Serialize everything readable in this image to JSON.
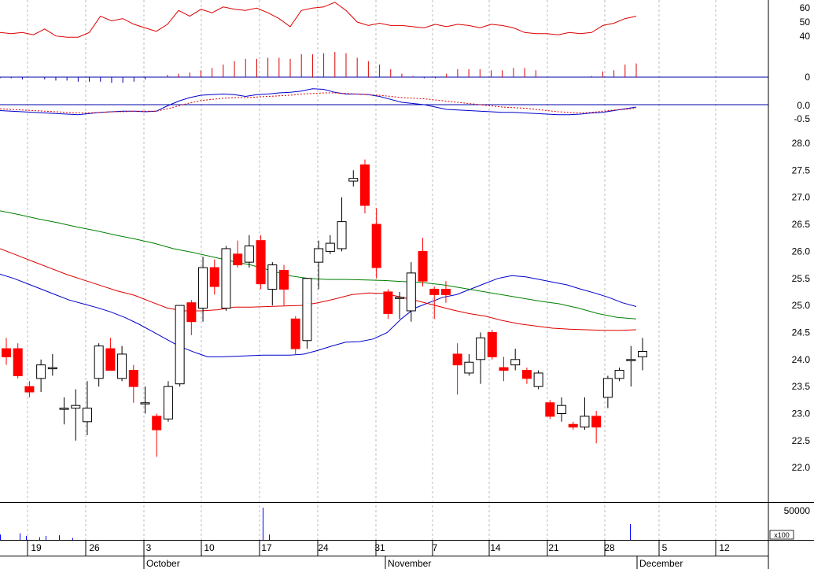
{
  "colors": {
    "up": "#ffffff",
    "down": "#ff0000",
    "outline": "#000000",
    "ma_short": "#0000cc",
    "ma_mid": "#dd0000",
    "ma_long": "#008000",
    "macd": "#0000cc",
    "signal": "#dd0000",
    "rsi": "#dd0000",
    "volume": "#0000ff",
    "grid": "#bbbbbb",
    "baseline": "#0000aa"
  },
  "chart_data": [
    {
      "type": "line",
      "panel": "rsi",
      "y_ticks": [
        "60",
        "50",
        "40"
      ],
      "ylim": [
        28,
        66
      ],
      "values": [
        38,
        37,
        38,
        36,
        41,
        35,
        34,
        34,
        38,
        52,
        48,
        50,
        45,
        42,
        39,
        45,
        57,
        52,
        58,
        55,
        60,
        58,
        57,
        59,
        55,
        50,
        43,
        57,
        59,
        60,
        64,
        57,
        47,
        44,
        46,
        44,
        44,
        43,
        42,
        45,
        43,
        45,
        44,
        42,
        45,
        44,
        42,
        38,
        37,
        37,
        36,
        38,
        37,
        38,
        44,
        46,
        50,
        52
      ]
    },
    {
      "type": "bar",
      "panel": "momentum",
      "y_ticks": [
        "0"
      ],
      "values": [
        -1,
        -1,
        -2,
        0,
        -2,
        -3,
        -3,
        -4,
        -4,
        -4,
        -5,
        -5,
        -4,
        -2,
        0,
        2,
        3,
        4,
        6,
        8,
        11,
        14,
        16,
        16,
        17,
        17,
        16,
        20,
        20,
        21,
        22,
        21,
        17,
        14,
        11,
        7,
        3,
        1,
        -1,
        -1,
        3,
        7,
        7,
        7,
        6,
        6,
        8,
        8,
        6,
        0,
        0,
        0,
        0,
        1,
        5,
        6,
        11,
        12
      ]
    },
    {
      "type": "line",
      "panel": "macd",
      "y_ticks": [
        "0.0",
        "-0.5"
      ],
      "ylim": [
        -1.4,
        1.5
      ],
      "series": [
        {
          "role": "macd",
          "values": [
            -0.5,
            -0.55,
            -0.6,
            -0.65,
            -0.7,
            -0.75,
            -0.8,
            -0.85,
            -0.75,
            -0.65,
            -0.6,
            -0.55,
            -0.55,
            -0.6,
            -0.55,
            -0.1,
            0.3,
            0.6,
            0.8,
            0.85,
            0.9,
            0.85,
            0.7,
            0.85,
            0.9,
            1.0,
            1.05,
            1.15,
            1.35,
            1.3,
            1.05,
            0.9,
            0.9,
            0.85,
            0.7,
            0.45,
            0.2,
            0.1,
            0.0,
            -0.2,
            -0.4,
            -0.45,
            -0.5,
            -0.55,
            -0.6,
            -0.65,
            -0.65,
            -0.7,
            -0.75,
            -0.8,
            -0.85,
            -0.85,
            -0.8,
            -0.7,
            -0.65,
            -0.5,
            -0.35,
            -0.2
          ]
        },
        {
          "role": "signal",
          "values": [
            -0.35,
            -0.4,
            -0.45,
            -0.5,
            -0.55,
            -0.6,
            -0.65,
            -0.7,
            -0.7,
            -0.65,
            -0.6,
            -0.6,
            -0.55,
            -0.55,
            -0.55,
            -0.35,
            -0.1,
            0.15,
            0.35,
            0.45,
            0.55,
            0.6,
            0.6,
            0.65,
            0.7,
            0.75,
            0.8,
            0.9,
            0.95,
            1.0,
            1.0,
            0.95,
            0.9,
            0.85,
            0.8,
            0.7,
            0.6,
            0.55,
            0.5,
            0.4,
            0.3,
            0.2,
            0.1,
            0.0,
            -0.1,
            -0.2,
            -0.25,
            -0.3,
            -0.4,
            -0.5,
            -0.6,
            -0.65,
            -0.7,
            -0.65,
            -0.55,
            -0.45,
            -0.4,
            -0.3
          ]
        }
      ]
    },
    {
      "type": "candlestick",
      "panel": "price",
      "y_ticks": [
        "28.0",
        "27.5",
        "27.0",
        "26.5",
        "26.0",
        "25.5",
        "25.0",
        "24.5",
        "24.0",
        "23.5",
        "23.0",
        "22.5",
        "22.0"
      ],
      "ylim": [
        21.6,
        28.4
      ],
      "candles": [
        {
          "o": 24.2,
          "h": 24.4,
          "l": 23.9,
          "c": 24.05
        },
        {
          "o": 24.2,
          "h": 24.3,
          "l": 23.65,
          "c": 23.7
        },
        {
          "o": 23.5,
          "h": 23.6,
          "l": 23.3,
          "c": 23.4
        },
        {
          "o": 23.65,
          "h": 24.0,
          "l": 23.4,
          "c": 23.9
        },
        {
          "o": 23.85,
          "h": 24.1,
          "l": 23.7,
          "c": 23.85
        },
        {
          "o": 23.1,
          "h": 23.3,
          "l": 22.8,
          "c": 23.1
        },
        {
          "o": 23.1,
          "h": 23.45,
          "l": 22.5,
          "c": 23.15
        },
        {
          "o": 22.85,
          "h": 23.6,
          "l": 22.6,
          "c": 23.1
        },
        {
          "o": 23.65,
          "h": 24.3,
          "l": 23.5,
          "c": 24.25
        },
        {
          "o": 24.2,
          "h": 24.4,
          "l": 23.8,
          "c": 23.8
        },
        {
          "o": 23.65,
          "h": 24.25,
          "l": 23.6,
          "c": 24.1
        },
        {
          "o": 23.8,
          "h": 23.9,
          "l": 23.2,
          "c": 23.5
        },
        {
          "o": 23.2,
          "h": 23.5,
          "l": 23.0,
          "c": 23.2
        },
        {
          "o": 22.95,
          "h": 23.0,
          "l": 22.2,
          "c": 22.7
        },
        {
          "o": 22.9,
          "h": 23.6,
          "l": 22.85,
          "c": 23.5
        },
        {
          "o": 23.55,
          "h": 25.0,
          "l": 23.5,
          "c": 25.0
        },
        {
          "o": 25.05,
          "h": 25.1,
          "l": 24.45,
          "c": 24.7
        },
        {
          "o": 24.95,
          "h": 25.9,
          "l": 24.7,
          "c": 25.7
        },
        {
          "o": 25.7,
          "h": 25.85,
          "l": 25.2,
          "c": 25.35
        },
        {
          "o": 24.95,
          "h": 26.1,
          "l": 24.9,
          "c": 26.05
        },
        {
          "o": 25.95,
          "h": 26.2,
          "l": 25.7,
          "c": 25.75
        },
        {
          "o": 25.8,
          "h": 26.3,
          "l": 25.7,
          "c": 26.1
        },
        {
          "o": 26.2,
          "h": 26.3,
          "l": 25.3,
          "c": 25.4
        },
        {
          "o": 25.3,
          "h": 25.8,
          "l": 25.0,
          "c": 25.75
        },
        {
          "o": 25.65,
          "h": 25.75,
          "l": 25.0,
          "c": 25.3
        },
        {
          "o": 24.75,
          "h": 24.8,
          "l": 24.1,
          "c": 24.2
        },
        {
          "o": 24.35,
          "h": 25.5,
          "l": 24.2,
          "c": 25.5
        },
        {
          "o": 25.8,
          "h": 26.2,
          "l": 25.3,
          "c": 26.05
        },
        {
          "o": 26.0,
          "h": 26.3,
          "l": 25.95,
          "c": 26.15
        },
        {
          "o": 26.05,
          "h": 27.0,
          "l": 26.0,
          "c": 26.55
        },
        {
          "o": 27.3,
          "h": 27.5,
          "l": 27.2,
          "c": 27.35
        },
        {
          "o": 27.6,
          "h": 27.7,
          "l": 26.7,
          "c": 26.85
        },
        {
          "o": 26.5,
          "h": 26.8,
          "l": 25.5,
          "c": 25.7
        },
        {
          "o": 25.25,
          "h": 25.3,
          "l": 24.75,
          "c": 24.85
        },
        {
          "o": 25.15,
          "h": 25.25,
          "l": 24.75,
          "c": 25.15
        },
        {
          "o": 24.9,
          "h": 25.8,
          "l": 24.7,
          "c": 25.6
        },
        {
          "o": 26.0,
          "h": 26.25,
          "l": 25.35,
          "c": 25.45
        },
        {
          "o": 25.3,
          "h": 25.35,
          "l": 24.75,
          "c": 25.2
        },
        {
          "o": 25.3,
          "h": 25.45,
          "l": 25.05,
          "c": 25.2
        },
        {
          "o": 24.1,
          "h": 24.3,
          "l": 23.35,
          "c": 23.9
        },
        {
          "o": 23.75,
          "h": 24.1,
          "l": 23.7,
          "c": 23.95
        },
        {
          "o": 24.0,
          "h": 24.5,
          "l": 23.55,
          "c": 24.4
        },
        {
          "o": 24.5,
          "h": 24.55,
          "l": 24.0,
          "c": 24.05
        },
        {
          "o": 23.85,
          "h": 24.05,
          "l": 23.6,
          "c": 23.8
        },
        {
          "o": 23.9,
          "h": 24.2,
          "l": 23.8,
          "c": 24.0
        },
        {
          "o": 23.8,
          "h": 23.85,
          "l": 23.55,
          "c": 23.65
        },
        {
          "o": 23.5,
          "h": 23.8,
          "l": 23.45,
          "c": 23.75
        },
        {
          "o": 23.2,
          "h": 23.25,
          "l": 22.9,
          "c": 22.95
        },
        {
          "o": 23.0,
          "h": 23.3,
          "l": 22.85,
          "c": 23.15
        },
        {
          "o": 22.8,
          "h": 22.85,
          "l": 22.7,
          "c": 22.75
        },
        {
          "o": 22.75,
          "h": 23.3,
          "l": 22.7,
          "c": 22.95
        },
        {
          "o": 22.95,
          "h": 23.05,
          "l": 22.45,
          "c": 22.75
        },
        {
          "o": 23.3,
          "h": 23.7,
          "l": 23.1,
          "c": 23.65
        },
        {
          "o": 23.65,
          "h": 23.85,
          "l": 23.6,
          "c": 23.8
        },
        {
          "o": 24.0,
          "h": 24.25,
          "l": 23.5,
          "c": 24.0
        },
        {
          "o": 24.05,
          "h": 24.4,
          "l": 23.8,
          "c": 24.15
        }
      ],
      "moving_averages": [
        {
          "role": "short",
          "values": [
            25.58,
            25.5,
            25.4,
            25.3,
            25.2,
            25.1,
            25.03,
            24.96,
            24.88,
            24.78,
            24.66,
            24.52,
            24.38,
            24.24,
            24.14,
            24.05,
            24.05,
            24.06,
            24.07,
            24.08,
            24.08,
            24.08,
            24.1,
            24.17,
            24.25,
            24.32,
            24.33,
            24.38,
            24.5,
            24.75,
            24.95,
            25.05,
            25.15,
            25.2,
            25.3,
            25.4,
            25.5,
            25.55,
            25.53,
            25.48,
            25.43,
            25.38,
            25.3,
            25.23,
            25.15,
            25.05,
            24.98
          ]
        },
        {
          "role": "mid",
          "values": [
            26.05,
            25.93,
            25.81,
            25.69,
            25.57,
            25.47,
            25.37,
            25.27,
            25.19,
            25.07,
            24.95,
            24.9,
            24.9,
            24.92,
            24.97,
            24.97,
            24.98,
            24.99,
            25.0,
            25.05,
            25.12,
            25.2,
            25.23,
            25.22,
            25.15,
            25.08,
            25.0,
            24.92,
            24.85,
            24.8,
            24.72,
            24.66,
            24.62,
            24.58,
            24.56,
            24.55,
            24.54,
            24.54,
            24.55
          ]
        },
        {
          "role": "long",
          "values": [
            26.75,
            26.68,
            26.6,
            26.53,
            26.45,
            26.38,
            26.3,
            26.23,
            26.15,
            26.05,
            25.98,
            25.9,
            25.82,
            25.75,
            25.65,
            25.55,
            25.5,
            25.48,
            25.48,
            25.47,
            25.46,
            25.44,
            25.42,
            25.38,
            25.32,
            25.26,
            25.2,
            25.14,
            25.08,
            25.03,
            24.95,
            24.85,
            24.78,
            24.75
          ]
        }
      ]
    },
    {
      "type": "bar",
      "panel": "volume",
      "y_ticks": [
        "50000"
      ],
      "unit": "x100",
      "ylim": [
        0,
        55000
      ],
      "values": [
        8000,
        0,
        0,
        10000,
        6000,
        0,
        4000,
        6000,
        0,
        7000,
        0,
        3000,
        0,
        0,
        0,
        0,
        0,
        0,
        0,
        0,
        0,
        0,
        0,
        0,
        0,
        0,
        0,
        0,
        0,
        0,
        0,
        0,
        0,
        0,
        0,
        0,
        0,
        0,
        0,
        0,
        49000,
        8000,
        0,
        0,
        0,
        0,
        0,
        0,
        0,
        0,
        0,
        0,
        0,
        0,
        0,
        0,
        0,
        0,
        0,
        0,
        0,
        0,
        0,
        0,
        0,
        0,
        0,
        0,
        0,
        0,
        0,
        0,
        0,
        0,
        0,
        0,
        0,
        0,
        0,
        0,
        0,
        0,
        0,
        0,
        0,
        0,
        0,
        0,
        0,
        0,
        0,
        0,
        0,
        0,
        0,
        0,
        24000,
        0
      ]
    },
    {
      "type": "axis",
      "panel": "dates",
      "day_labels": [
        "19",
        "26",
        "3",
        "10",
        "17",
        "24",
        "31",
        "7",
        "14",
        "21",
        "28",
        "5",
        "12"
      ],
      "month_labels": [
        "October",
        "November",
        "December"
      ]
    }
  ]
}
